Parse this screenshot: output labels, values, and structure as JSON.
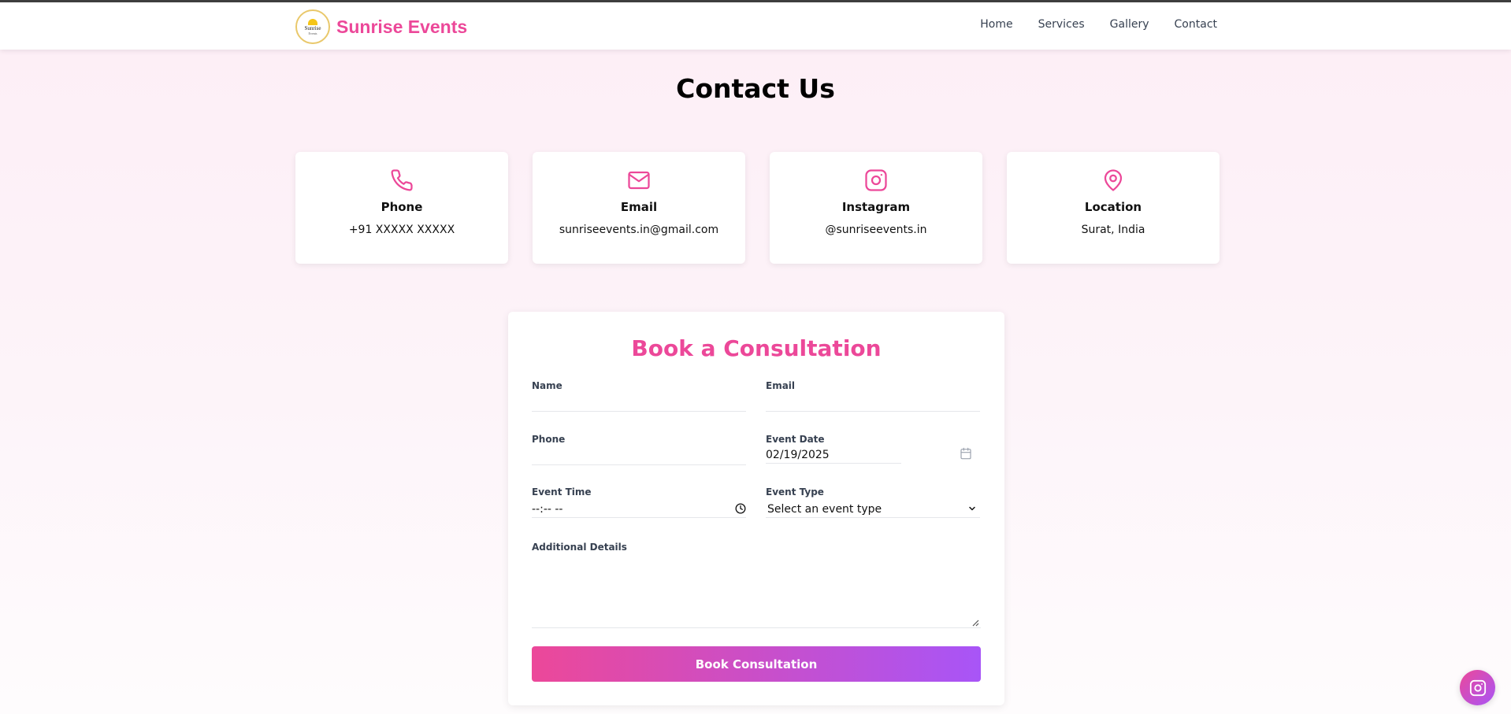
{
  "header": {
    "brand_name": "Sunrise Events",
    "logo_text": "Sunrise",
    "logo_sub": "Events",
    "nav": [
      {
        "label": "Home"
      },
      {
        "label": "Services"
      },
      {
        "label": "Gallery"
      },
      {
        "label": "Contact"
      }
    ]
  },
  "page": {
    "title": "Contact Us"
  },
  "cards": [
    {
      "icon": "phone-icon",
      "label": "Phone",
      "value": "+91 XXXXX XXXXX"
    },
    {
      "icon": "mail-icon",
      "label": "Email",
      "value": "sunriseevents.in@gmail.com"
    },
    {
      "icon": "instagram-icon",
      "label": "Instagram",
      "value": "@sunriseevents.in"
    },
    {
      "icon": "map-pin-icon",
      "label": "Location",
      "value": "Surat, India"
    }
  ],
  "form": {
    "title": "Book a Consultation",
    "name_label": "Name",
    "name_value": "",
    "email_label": "Email",
    "email_value": "",
    "phone_label": "Phone",
    "phone_value": "",
    "date_label": "Event Date",
    "date_value": "02/19/2025",
    "time_label": "Event Time",
    "time_value": "--:-- --",
    "type_label": "Event Type",
    "type_value": "Select an event type",
    "details_label": "Additional Details",
    "details_value": "",
    "submit_label": "Book Consultation"
  },
  "colors": {
    "accent": "#ec4899",
    "gradient_end": "#a855f7"
  }
}
